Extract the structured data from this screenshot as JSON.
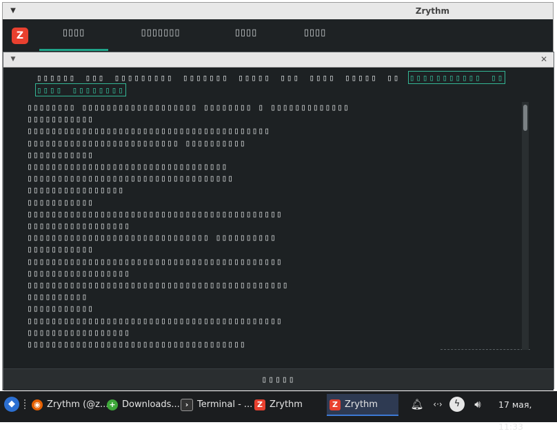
{
  "outer_window": {
    "title": "Zrythm",
    "menu_icon": "chevron-down-icon",
    "logo_text": "Z",
    "header_tabs": [
      {
        "label": "▯▯▯▯",
        "active": true
      },
      {
        "label": "▯▯▯▯▯▯▯",
        "active": false
      },
      {
        "label": "▯▯▯▯",
        "active": false
      },
      {
        "label": "▯▯▯▯",
        "active": false
      }
    ]
  },
  "dialog": {
    "menu_icon": "chevron-down-icon",
    "close_icon": "close-icon",
    "heading_text": "▯▯▯▯▯▯ ▯▯▯ ▯▯▯▯▯▯▯▯▯ ▯▯▯▯▯▯▯ ▯▯▯▯▯ ▯▯▯ ▯▯▯▯ ▯▯▯▯▯ ▯▯ ",
    "heading_link": "▯▯▯▯▯▯▯▯▯▯▯ ▯▯ ▯▯▯▯ ▯▯▯▯▯▯▯▯",
    "log_lines": [
      "▯▯▯▯▯▯▯▯ ▯▯▯▯▯▯▯▯▯▯▯▯▯▯▯▯▯▯▯ ▯▯▯▯▯▯▯▯ ▯ ▯▯▯▯▯▯▯▯▯▯▯▯▯",
      "▯▯▯▯▯▯▯▯▯▯▯",
      "▯▯▯▯▯▯▯▯▯▯▯▯▯▯▯▯▯▯▯▯▯▯▯▯▯▯▯▯▯▯▯▯▯▯▯▯▯▯▯▯",
      "▯▯▯▯▯▯▯▯▯▯▯▯▯▯▯▯▯▯▯▯▯▯▯▯▯ ▯▯▯▯▯▯▯▯▯▯",
      "▯▯▯▯▯▯▯▯▯▯▯",
      "▯▯▯▯▯▯▯▯▯▯▯▯▯▯▯▯▯▯▯▯▯▯▯▯▯▯▯▯▯▯▯▯▯",
      "▯▯▯▯▯▯▯▯▯▯▯▯▯▯▯▯▯▯▯▯▯▯▯▯▯▯▯▯▯▯▯▯▯▯",
      "▯▯▯▯▯▯▯▯▯▯▯▯▯▯▯▯",
      "▯▯▯▯▯▯▯▯▯▯▯",
      "▯▯▯▯▯▯▯▯▯▯▯▯▯▯▯▯▯▯▯▯▯▯▯▯▯▯▯▯▯▯▯▯▯▯▯▯▯▯▯▯▯▯",
      "▯▯▯▯▯▯▯▯▯▯▯▯▯▯▯▯▯",
      "▯▯▯▯▯▯▯▯▯▯▯▯▯▯▯▯▯▯▯▯▯▯▯▯▯▯▯▯▯▯ ▯▯▯▯▯▯▯▯▯▯",
      "▯▯▯▯▯▯▯▯▯▯▯",
      "▯▯▯▯▯▯▯▯▯▯▯▯▯▯▯▯▯▯▯▯▯▯▯▯▯▯▯▯▯▯▯▯▯▯▯▯▯▯▯▯▯▯",
      "▯▯▯▯▯▯▯▯▯▯▯▯▯▯▯▯▯",
      "▯▯▯▯▯▯▯▯▯▯▯▯▯▯▯▯▯▯▯▯▯▯▯▯▯▯▯▯▯▯▯▯▯▯▯▯▯▯▯▯▯▯▯",
      "▯▯▯▯▯▯▯▯▯▯",
      "▯▯▯▯▯▯▯▯▯▯▯",
      "▯▯▯▯▯▯▯▯▯▯▯▯▯▯▯▯▯▯▯▯▯▯▯▯▯▯▯▯▯▯▯▯▯▯▯▯▯▯▯▯▯▯",
      "▯▯▯▯▯▯▯▯▯▯▯▯▯▯▯▯▯",
      "▯▯▯▯▯▯▯▯▯▯▯▯▯▯▯▯▯▯▯▯▯▯▯▯▯▯▯▯▯▯▯▯▯▯▯▯"
    ],
    "footer_button_label": "▯▯▯▯▯"
  },
  "taskbar": {
    "start_icon": "start-menu-icon",
    "items": [
      {
        "label": "Zrythm (@z...",
        "icon": "firefox-icon",
        "icon_color": "#e66000",
        "active": false
      },
      {
        "label": "Downloads...",
        "icon": "download-icon",
        "icon_color": "#3ea83a",
        "active": false
      },
      {
        "label": "Terminal - ...",
        "icon": "terminal-icon",
        "icon_color": "#333333",
        "active": false
      },
      {
        "label": "Zrythm",
        "icon": "zrythm-icon",
        "icon_color": "#e8402f",
        "active": false
      },
      {
        "label": "Zrythm",
        "icon": "zrythm-icon",
        "icon_color": "#e8402f",
        "active": true
      }
    ],
    "tray_icons": [
      "notification-bell-icon",
      "network-arrows-icon",
      "power-icon",
      "volume-icon"
    ],
    "clock": "17 мая, 11:33"
  }
}
